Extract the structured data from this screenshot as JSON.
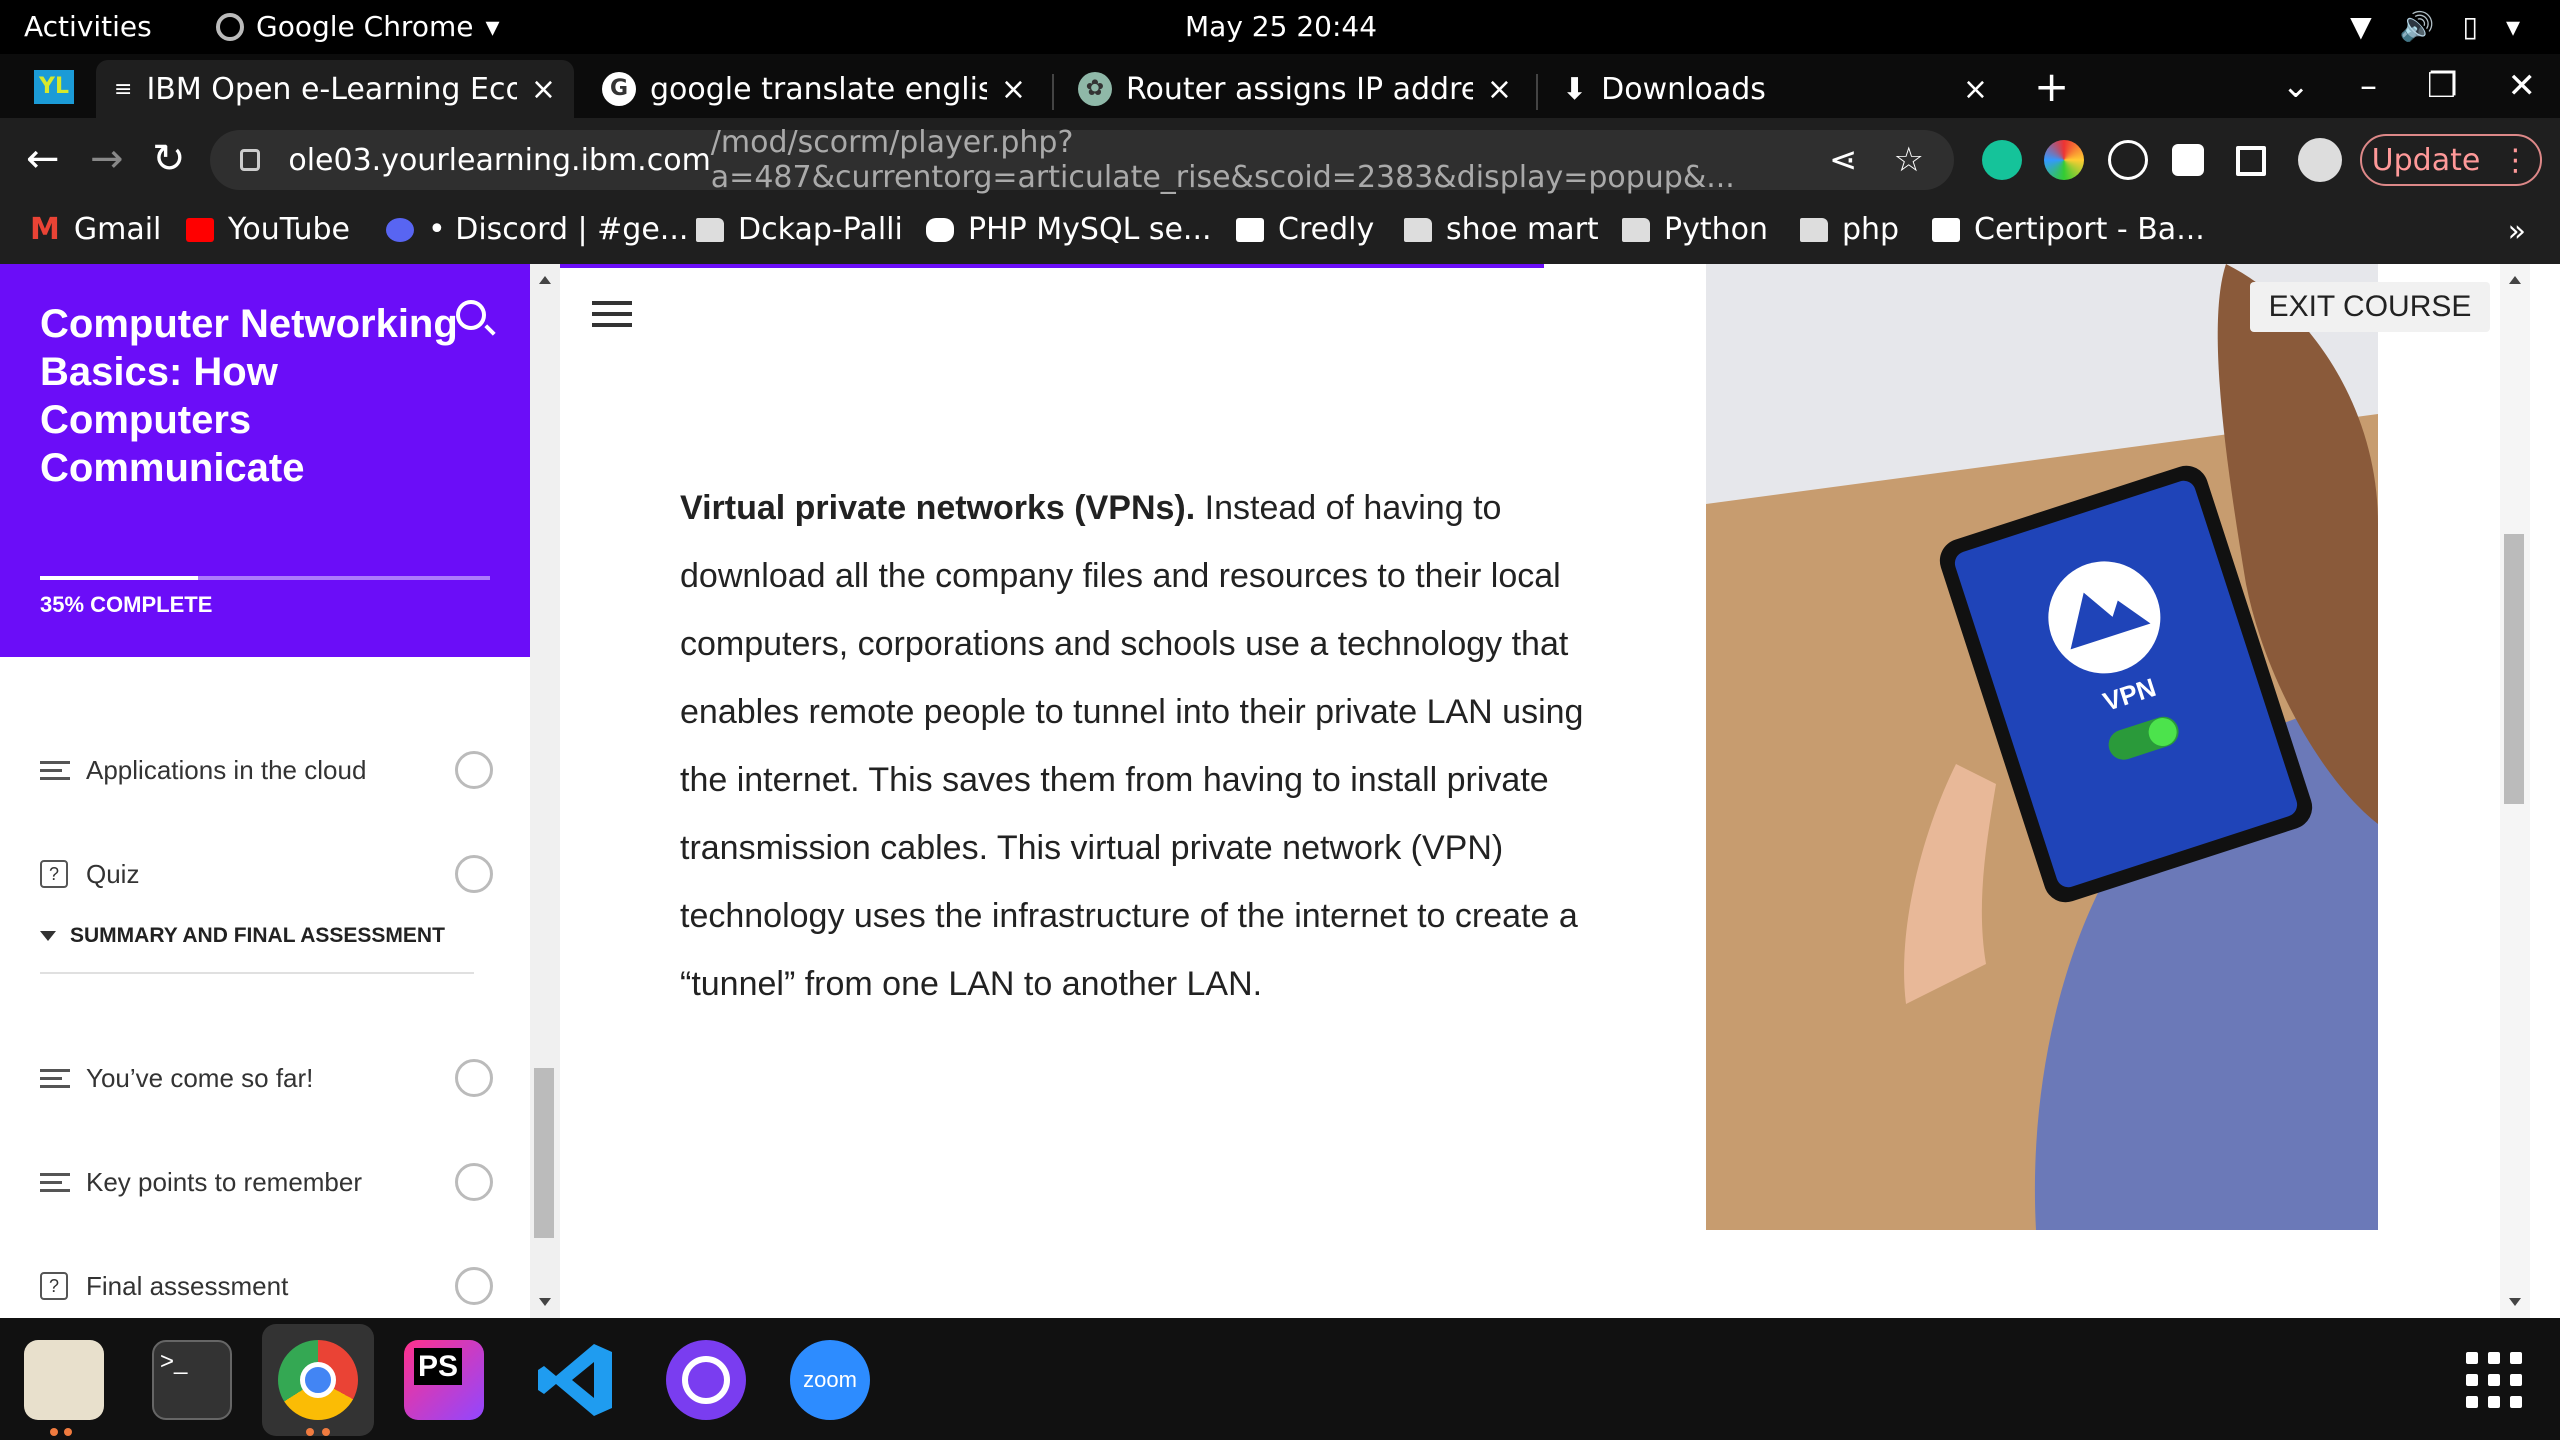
{
  "topbar": {
    "activities": "Activities",
    "app_name": "Google Chrome",
    "clock": "May 25  20:44"
  },
  "tabs": [
    {
      "title": "IBM Open e-Learning Ecos",
      "close": "×"
    },
    {
      "title": "google translate english t",
      "close": "×"
    },
    {
      "title": "Router assigns IP address",
      "close": "×"
    },
    {
      "title": "Downloads",
      "close": "×"
    }
  ],
  "toolbar": {
    "url_host": "ole03.yourlearning.ibm.com",
    "url_path": "/mod/scorm/player.php?a=487&currentorg=articulate_rise&scoid=2383&display=popup&...",
    "update_label": "Update"
  },
  "bookmarks": [
    {
      "label": "Gmail",
      "icon": "gmail-icon"
    },
    {
      "label": "YouTube",
      "icon": "youtube-icon"
    },
    {
      "label": "• Discord | #ge...",
      "icon": "discord-icon"
    },
    {
      "label": "Dckap-Palli",
      "icon": "folder-icon"
    },
    {
      "label": "PHP MySQL se...",
      "icon": "medium-icon"
    },
    {
      "label": "Credly",
      "icon": "credly-icon"
    },
    {
      "label": "shoe mart",
      "icon": "folder-icon"
    },
    {
      "label": "Python",
      "icon": "folder-icon"
    },
    {
      "label": "php",
      "icon": "folder-icon"
    },
    {
      "label": "Certiport - Ba...",
      "icon": "credly-icon"
    }
  ],
  "sidebar": {
    "course_title": "Computer Networking Basics: How Computers Communicate",
    "progress_label": "35% COMPLETE",
    "progress_fraction": 0.35,
    "lessons_top": [
      {
        "label": "Applications in the cloud",
        "type": "lesson"
      },
      {
        "label": "Quiz",
        "type": "quiz"
      }
    ],
    "section_title": "SUMMARY AND FINAL ASSESSMENT",
    "lessons_bottom": [
      {
        "label": "You’ve come so far!",
        "type": "lesson"
      },
      {
        "label": "Key points to remember",
        "type": "lesson"
      },
      {
        "label": "Final assessment",
        "type": "quiz"
      }
    ]
  },
  "content": {
    "lead_bold": "Virtual private networks (VPNs).",
    "body": " Instead of having to download all the company files and resources to their local computers, corporations and schools use a technology that enables remote people to tunnel into their private LAN using the internet. This saves them from having to install private transmission cables. This virtual private network (VPN) technology uses the infrastructure of the internet to create a “tunnel” from one LAN to another LAN.",
    "image_vpn_label": "VPN",
    "exit_label": "EXIT COURSE"
  },
  "dock": {
    "zoom_label": "zoom",
    "phpstorm_label": "PS"
  },
  "colors": {
    "brand_purple": "#6b0df8",
    "chrome_dark": "#1f1f1f"
  }
}
